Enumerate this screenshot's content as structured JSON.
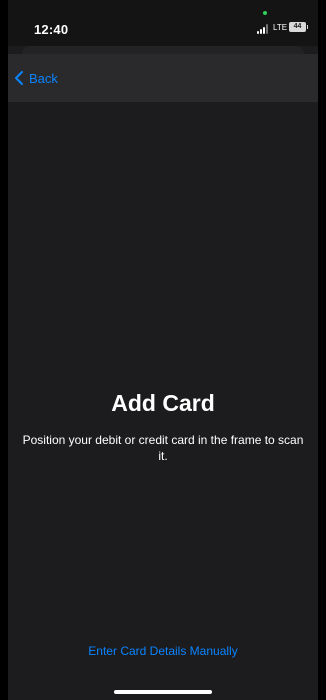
{
  "status_bar": {
    "time": "12:40",
    "network": "LTE",
    "battery": "44"
  },
  "nav": {
    "back_label": "Back"
  },
  "main": {
    "title": "Add Card",
    "instructions": "Position your debit or credit card in the frame to scan it.",
    "manual_entry_label": "Enter Card Details Manually"
  },
  "colors": {
    "accent": "#0a84ff",
    "background": "#1c1c1e",
    "nav_background": "#2a2a2c",
    "mic_indicator": "#30d158"
  },
  "icons": [
    "signal-icon",
    "battery-icon",
    "back-chevron-icon",
    "mic-indicator-dot"
  ]
}
